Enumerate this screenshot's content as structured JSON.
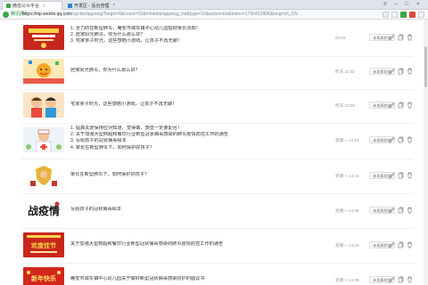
{
  "browser": {
    "tabs": [
      {
        "label": "微信公众平台",
        "icon_color": "#3aa648",
        "active": true
      },
      {
        "label": "开发区 - 后台管理",
        "icon_color": "#2f80d1",
        "active": false
      }
    ],
    "secure_label": "腾讯网",
    "url_host": "https://mp.weixin.qq.com",
    "url_path": "/cgi-bin/appmsg?begin=0&count=10&t=media/appmsg_list&type=10&action=list&token=1790422906&lang=zh_CN",
    "icons": {
      "secure": "secure-lock-icon"
    },
    "colors": {
      "accent": "#3aa648"
    }
  },
  "articles": [
    {
      "titles": [
        "1. 全力防控新型肺炎，庵安市城东镇中心幼儿园理财家长须知！",
        "2. 居家阳光肺炎，你为什么那么好？",
        "3. 宅家亲子时光，这些感晒小游戏，让孩子不再无聊！"
      ],
      "time": "00:02",
      "status": "未发表状态",
      "thumb": "poster-red"
    },
    {
      "titles": [
        "居家阳光肺炎，你为什么那么好？"
      ],
      "time": "昨天 23:32",
      "status": "未发表状态",
      "thumb": "cartoon-sun"
    },
    {
      "titles": [
        "宅家亲子时光，这些感晒小游戏，让孩子不再无聊！"
      ],
      "time": "昨天 23:26",
      "status": "未发表状态",
      "thumb": "cartoon-kids"
    },
    {
      "titles": [
        "1. 提高关爱保持应对知道、觉得做，感觉一定要配合！",
        "2. 关于加强大型商超和餐饮行业新型冠状病毒感染的肺炎疫情防控工作的通告",
        "3. 写给孩子的冠状病毒绘本",
        "4. 家长在新型肺炎下，如何保护好孩子？"
      ],
      "time": "星期一 13:51",
      "status": "未发表状态",
      "thumb": "cartoon-medic"
    },
    {
      "titles": [
        "家长在新型肺炎下，如何保护好孩子？"
      ],
      "time": "星期一 14:13",
      "status": "未发表状态",
      "thumb": "cartoon-shield"
    },
    {
      "titles": [
        "写给孩子的冠状病毒绘本"
      ],
      "time": "星期一 14:06",
      "status": "未发表状态",
      "thumb": "calligraphy"
    },
    {
      "titles": [
        "关于加强大型商超和餐饮行业新型冠状病毒感染的肺炎疫情防控工作的通告"
      ],
      "time": "星期一 14:00",
      "status": "未发表状态",
      "thumb": "festive-red"
    },
    {
      "titles": [
        "庵安市城东镇中心幼儿园关于做好新型冠状病毒感染防护的倡议书"
      ],
      "time": "星期一 14:08",
      "status": "未发表状态",
      "thumb": "newyear-red"
    }
  ],
  "row_icons": [
    "edit-icon",
    "copy-icon",
    "delete-icon"
  ],
  "thumb_texts": {
    "calligraphy": "战疫情",
    "festive-red": "欢度佳节",
    "newyear-red": "新年快乐"
  }
}
